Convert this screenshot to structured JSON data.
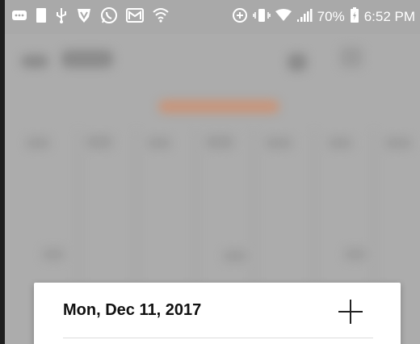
{
  "status_bar": {
    "left_icons": [
      "more-icon",
      "sim-icon",
      "usb-icon",
      "shield-v-icon",
      "whatsapp-icon",
      "gmail-icon",
      "wifi-ring-icon"
    ],
    "right_icons": [
      "data-saver-icon",
      "vibrate-icon",
      "wifi-icon",
      "signal-icon",
      "battery-icon"
    ],
    "battery_percent": "70%",
    "time": "6:52 PM"
  },
  "dialog": {
    "date": "Mon, Dec 11, 2017",
    "add_icon": "plus-icon"
  },
  "colors": {
    "status_bar_bg": "#a9a9a9",
    "screen_bg": "#b5b5b5",
    "dialog_bg": "#ffffff",
    "accent_blur": "#d79a7a"
  }
}
